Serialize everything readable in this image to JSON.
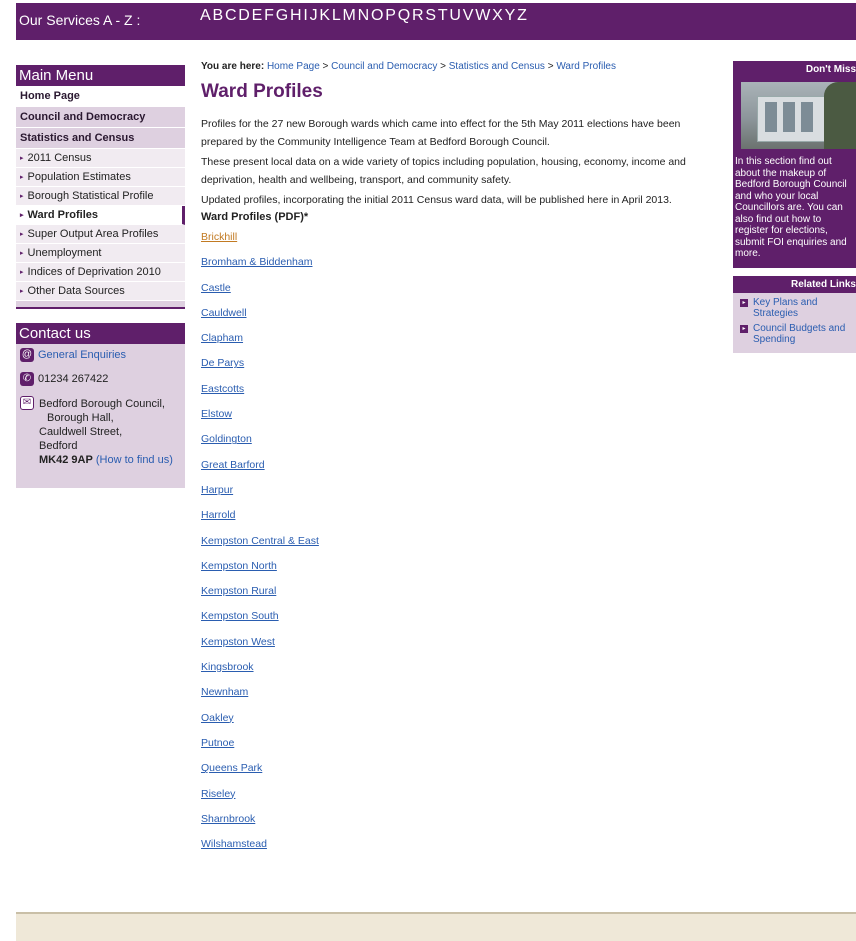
{
  "az_bar": {
    "title": "Our Services A - Z :",
    "letters": [
      "A",
      "B",
      "C",
      "D",
      "E",
      "F",
      "G",
      "H",
      "I",
      "J",
      "K",
      "L",
      "M",
      "N",
      "O",
      "P",
      "Q",
      "R",
      "S",
      "T",
      "U",
      "V",
      "W",
      "X",
      "Y",
      "Z"
    ]
  },
  "main_menu": {
    "heading": "Main Menu",
    "home": "Home Page",
    "council": "Council and Democracy",
    "stats": "Statistics and Census",
    "items": [
      {
        "label": "2011 Census",
        "active": false
      },
      {
        "label": "Population Estimates",
        "active": false
      },
      {
        "label": "Borough Statistical Profile",
        "active": false
      },
      {
        "label": "Ward Profiles",
        "active": true
      },
      {
        "label": "Super Output Area Profiles",
        "active": false
      },
      {
        "label": "Unemployment",
        "active": false
      },
      {
        "label": "Indices of Deprivation 2010",
        "active": false
      },
      {
        "label": "Other Data Sources",
        "active": false
      }
    ]
  },
  "contact": {
    "heading": "Contact us",
    "enquiries": "General Enquiries",
    "phone": "01234 267422",
    "address": [
      "Bedford Borough Council,",
      "Borough Hall,",
      "Cauldwell Street,",
      "Bedford"
    ],
    "postcode": "MK42 9AP",
    "find_us": "(How to find us)"
  },
  "breadcrumb": {
    "label": "You are here:",
    "items": [
      "Home Page",
      "Council and Democracy",
      "Statistics and Census",
      "Ward Profiles"
    ]
  },
  "page": {
    "title": "Ward Profiles",
    "para1": "Profiles for the 27 new Borough wards which came into effect for the 5th May 2011 elections have been prepared by the Community Intelligence Team at Bedford Borough Council.",
    "para2": "These present local data on a wide variety of topics including population, housing, economy, income and deprivation, health and wellbeing, transport, and community safety.",
    "para3": "Updated profiles, incorporating the initial 2011 Census ward data, will be published here in April 2013.",
    "list_heading": "Ward Profiles (PDF)*"
  },
  "wards": [
    "Brickhill",
    "Bromham & Biddenham",
    "Castle",
    "Cauldwell",
    "Clapham",
    "De Parys",
    "Eastcotts",
    "Elstow",
    "Goldington",
    "Great Barford",
    "Harpur",
    "Harrold",
    "Kempston Central & East",
    "Kempston North",
    "Kempston Rural",
    "Kempston South",
    "Kempston West",
    "Kingsbrook",
    "Newnham",
    "Oakley",
    "Putnoe",
    "Queens Park",
    "Riseley",
    "Sharnbrook",
    "Wilshamstead"
  ],
  "dont_miss": {
    "heading": "Don't Miss",
    "text": "In this section find out about the makeup of Bedford Borough Council and who your local Councillors are. You can also find out how to register for elections, submit FOI enquiries and more."
  },
  "related": {
    "heading": "Related Links",
    "links": [
      "Key Plans and Strategies",
      "Council Budgets and Spending"
    ]
  },
  "colors": {
    "brand_purple": "#5f1f6a",
    "link_blue": "#2a5db0",
    "visited_link": "#c27a22"
  }
}
